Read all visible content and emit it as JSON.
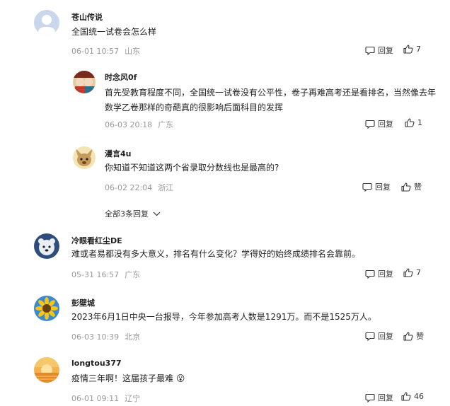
{
  "comments": [
    {
      "user": "苍山传说",
      "text": "全国统一试卷会怎么样",
      "date": "06-01 10:57",
      "location": "山东",
      "reply_label": "回复",
      "likes": "7"
    },
    {
      "user": "时念风0f",
      "text": "首先受教育程度不同，全国统一试卷没有公平性，卷子再难高考还是看排名，当然像去年数学乙卷那样的奇葩真的很影响后面科目的发挥",
      "date": "06-03 20:18",
      "location": "广东",
      "reply_label": "回复",
      "likes": "1"
    },
    {
      "user": "漫言4u",
      "text": "你知道不知道这两个省录取分数线也是最高的?",
      "date": "06-02 22:04",
      "location": "浙江",
      "reply_label": "回复",
      "likes": "赞"
    },
    {
      "user": "冷眼看红尘DE",
      "text": "难或者易都没有多大意义，排名有什么变化？学得好的始终成绩排名会靠前。",
      "date": "05-31 16:57",
      "location": "广东",
      "reply_label": "回复",
      "likes": "7"
    },
    {
      "user": "彭壁城",
      "text": "2023年6月1日中央一台报导，今年参加高考人数是1291万。而不是1525万人。",
      "date": "06-03 10:39",
      "location": "北京",
      "reply_label": "回复",
      "likes": "赞"
    },
    {
      "user": "longtou377",
      "text": "疫情三年啊！这届孩子最难",
      "date": "06-01 09:11",
      "location": "辽宁",
      "reply_label": "回复",
      "likes": "46"
    }
  ],
  "show_all_replies": "全部3条回复",
  "emoji": "😮"
}
